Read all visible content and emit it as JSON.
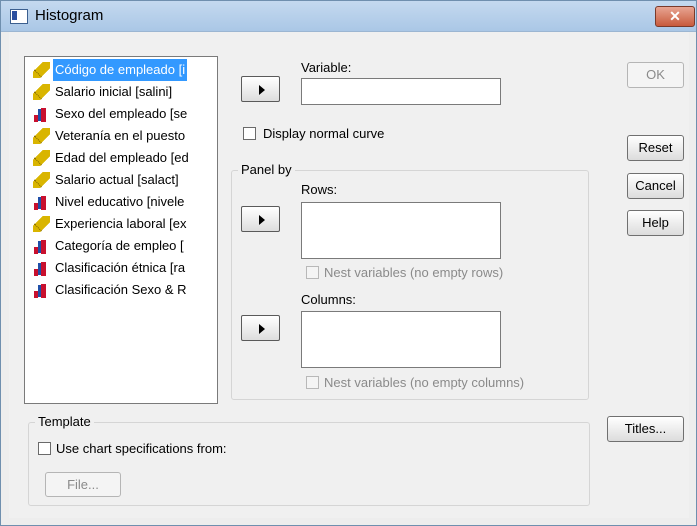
{
  "window": {
    "title": "Histogram",
    "close_label": "✕"
  },
  "variables": [
    {
      "label": "Código de empleado [i",
      "icon": "ruler-icon",
      "selected": true
    },
    {
      "label": "Salario inicial [salini]",
      "icon": "ruler-icon"
    },
    {
      "label": "Sexo del empleado [se",
      "icon": "bars-icon"
    },
    {
      "label": "Veteranía en el puesto",
      "icon": "ruler-icon"
    },
    {
      "label": "Edad del empleado [ed",
      "icon": "ruler-icon"
    },
    {
      "label": "Salario actual [salact]",
      "icon": "ruler-icon"
    },
    {
      "label": "Nivel educativo [nivele",
      "icon": "bars-icon"
    },
    {
      "label": "Experiencia laboral [ex",
      "icon": "ruler-icon"
    },
    {
      "label": "Categoría de empleo [",
      "icon": "bars-icon"
    },
    {
      "label": "Clasificación étnica [ra",
      "icon": "bars-icon"
    },
    {
      "label": "Clasificación Sexo & R",
      "icon": "bars-icon"
    }
  ],
  "variable": {
    "label": "Variable:",
    "value": ""
  },
  "display_normal_curve": {
    "label": "Display normal curve",
    "checked": false
  },
  "panel_by": {
    "title": "Panel by",
    "rows_label": "Rows:",
    "nest_rows_label": "Nest variables (no empty rows)",
    "columns_label": "Columns:",
    "nest_columns_label": "Nest variables (no empty columns)"
  },
  "template": {
    "title": "Template",
    "use_chart_label": "Use chart specifications from:",
    "file_label": "File..."
  },
  "buttons": {
    "ok": "OK",
    "reset": "Reset",
    "cancel": "Cancel",
    "help": "Help",
    "titles": "Titles..."
  }
}
